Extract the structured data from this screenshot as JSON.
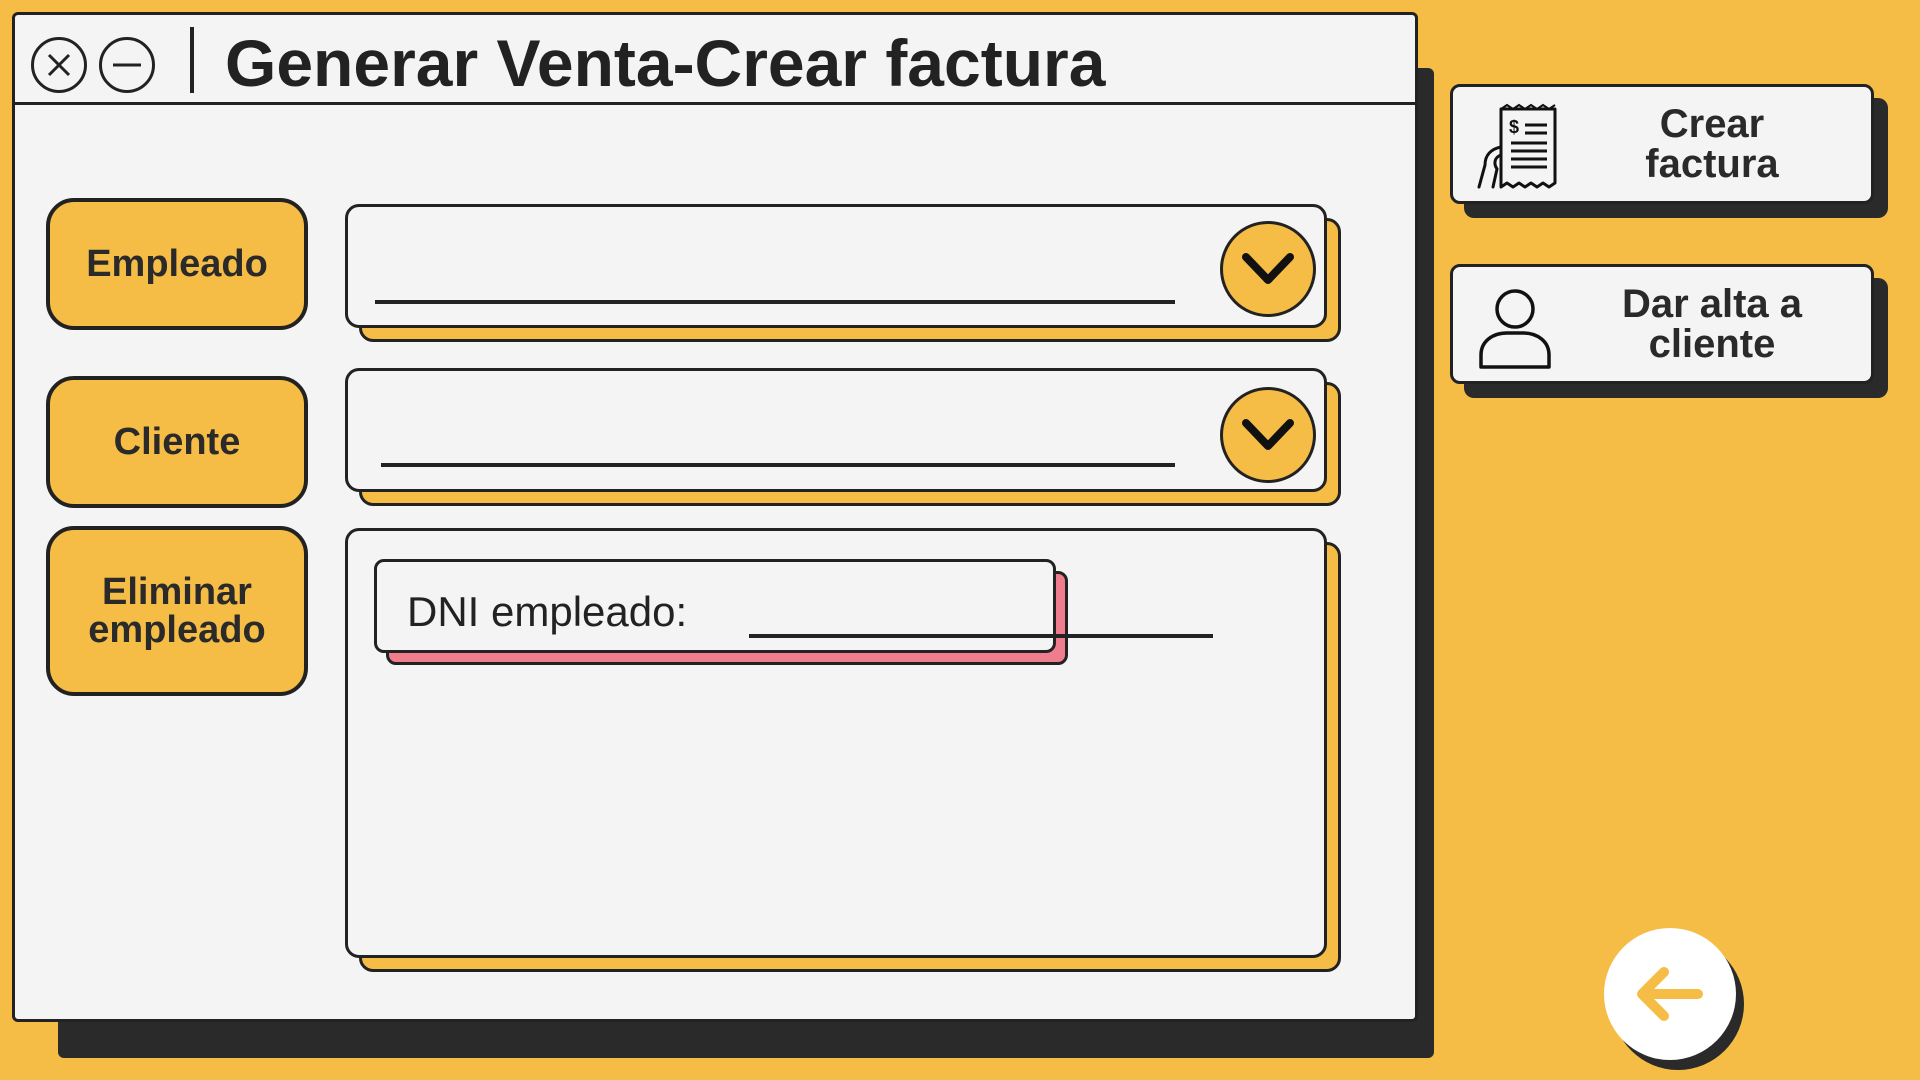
{
  "window": {
    "title": "Generar Venta-Crear factura",
    "close_icon": "close-icon",
    "minimize_icon": "minimize-icon"
  },
  "form": {
    "empleado": {
      "label": "Empleado",
      "value": "",
      "dropdown_icon": "chevron-down-icon"
    },
    "cliente": {
      "label": "Cliente",
      "value": "",
      "dropdown_icon": "chevron-down-icon"
    },
    "eliminar": {
      "label": "Eliminar empleado"
    },
    "dni": {
      "label": "DNI empleado:",
      "value": ""
    }
  },
  "sidebar": {
    "crear_factura": {
      "label": "Crear factura",
      "icon": "invoice-icon"
    },
    "dar_alta": {
      "label": "Dar alta a cliente",
      "icon": "user-icon"
    }
  },
  "back": {
    "icon": "arrow-left-icon"
  },
  "colors": {
    "background": "#F5BD45",
    "window": "#F4F4F4",
    "border": "#222222",
    "accent_pink": "#F07D8E"
  }
}
